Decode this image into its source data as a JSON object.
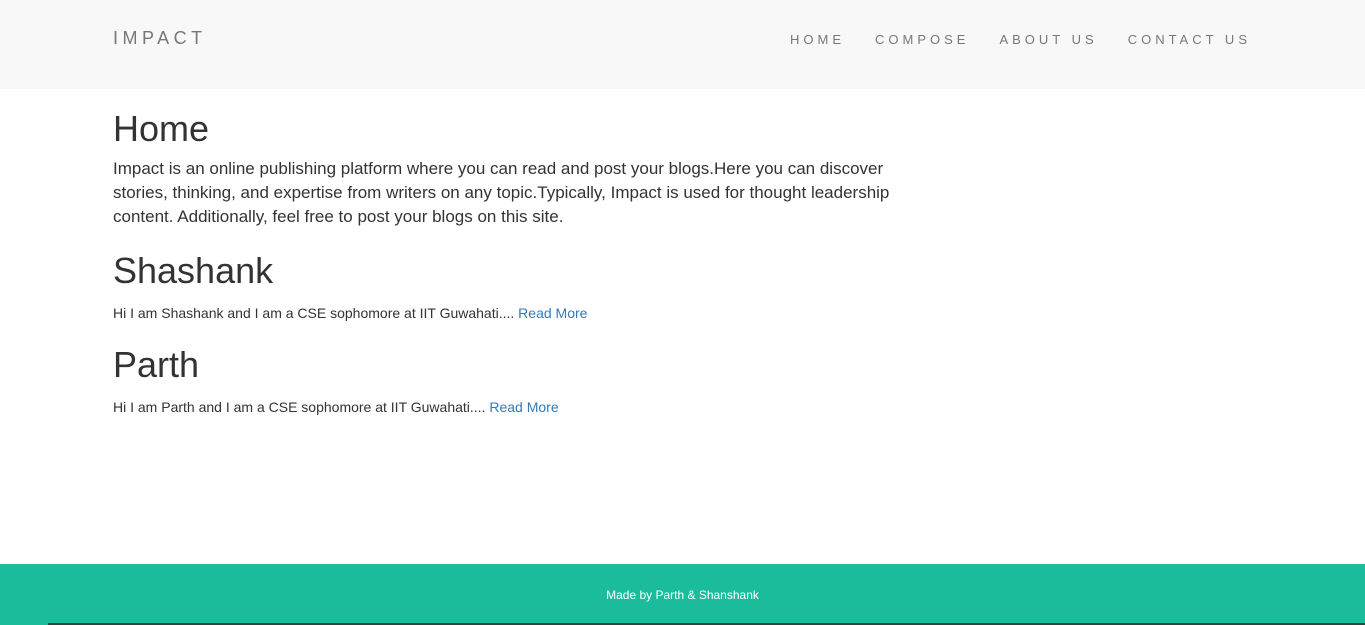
{
  "header": {
    "brand": "IMPACT",
    "nav": [
      {
        "label": "HOME"
      },
      {
        "label": "COMPOSE"
      },
      {
        "label": "ABOUT US"
      },
      {
        "label": "CONTACT US"
      }
    ]
  },
  "main": {
    "title": "Home",
    "intro": "Impact is an online publishing platform where you can read and post your blogs.Here you can discover stories, thinking, and expertise from writers on any topic.Typically, Impact is used for thought leadership content. Additionally, feel free to post your blogs on this site.",
    "posts": [
      {
        "title": "Shashank",
        "excerpt": "Hi I am Shashank and I am a CSE sophomore at IIT Guwahati....",
        "link": "Read More"
      },
      {
        "title": "Parth",
        "excerpt": "Hi I am Parth and I am a CSE sophomore at IIT Guwahati....",
        "link": "Read More"
      }
    ]
  },
  "footer": {
    "text": "Made by Parth & Shanshank"
  },
  "colors": {
    "footer_bg": "#1abc9c",
    "link": "#337ab7",
    "navbar_bg": "#f8f8f8"
  }
}
